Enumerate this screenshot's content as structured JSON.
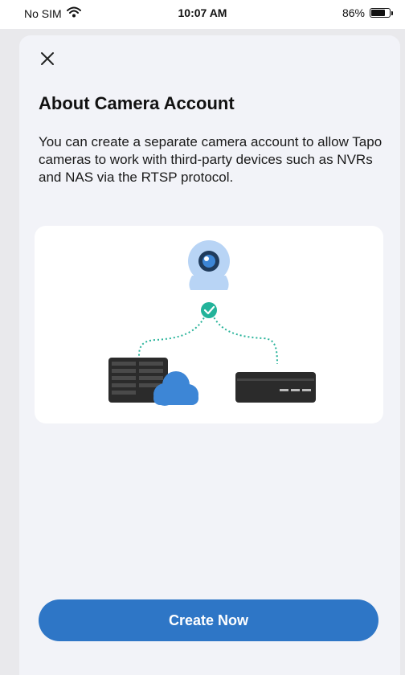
{
  "status_bar": {
    "carrier": "No SIM",
    "time": "10:07 AM",
    "battery_percent": "86%",
    "battery_level": 0.86
  },
  "sheet": {
    "title": "About Camera Account",
    "description": "You can create a separate camera account to allow Tapo cameras to work with third-party devices such as NVRs and NAS via the RTSP protocol.",
    "create_button_label": "Create Now"
  },
  "icons": {
    "close": "close-icon",
    "wifi": "wifi-icon",
    "camera": "camera-icon",
    "check": "check-icon",
    "nas": "nas-icon",
    "cloud": "cloud-icon",
    "nvr": "nvr-icon"
  },
  "colors": {
    "accent": "#2e76c6",
    "check": "#22b39a",
    "camera_light": "#b8d4f5",
    "cloud": "#3d86d6",
    "device_dark": "#2d2d2d"
  }
}
